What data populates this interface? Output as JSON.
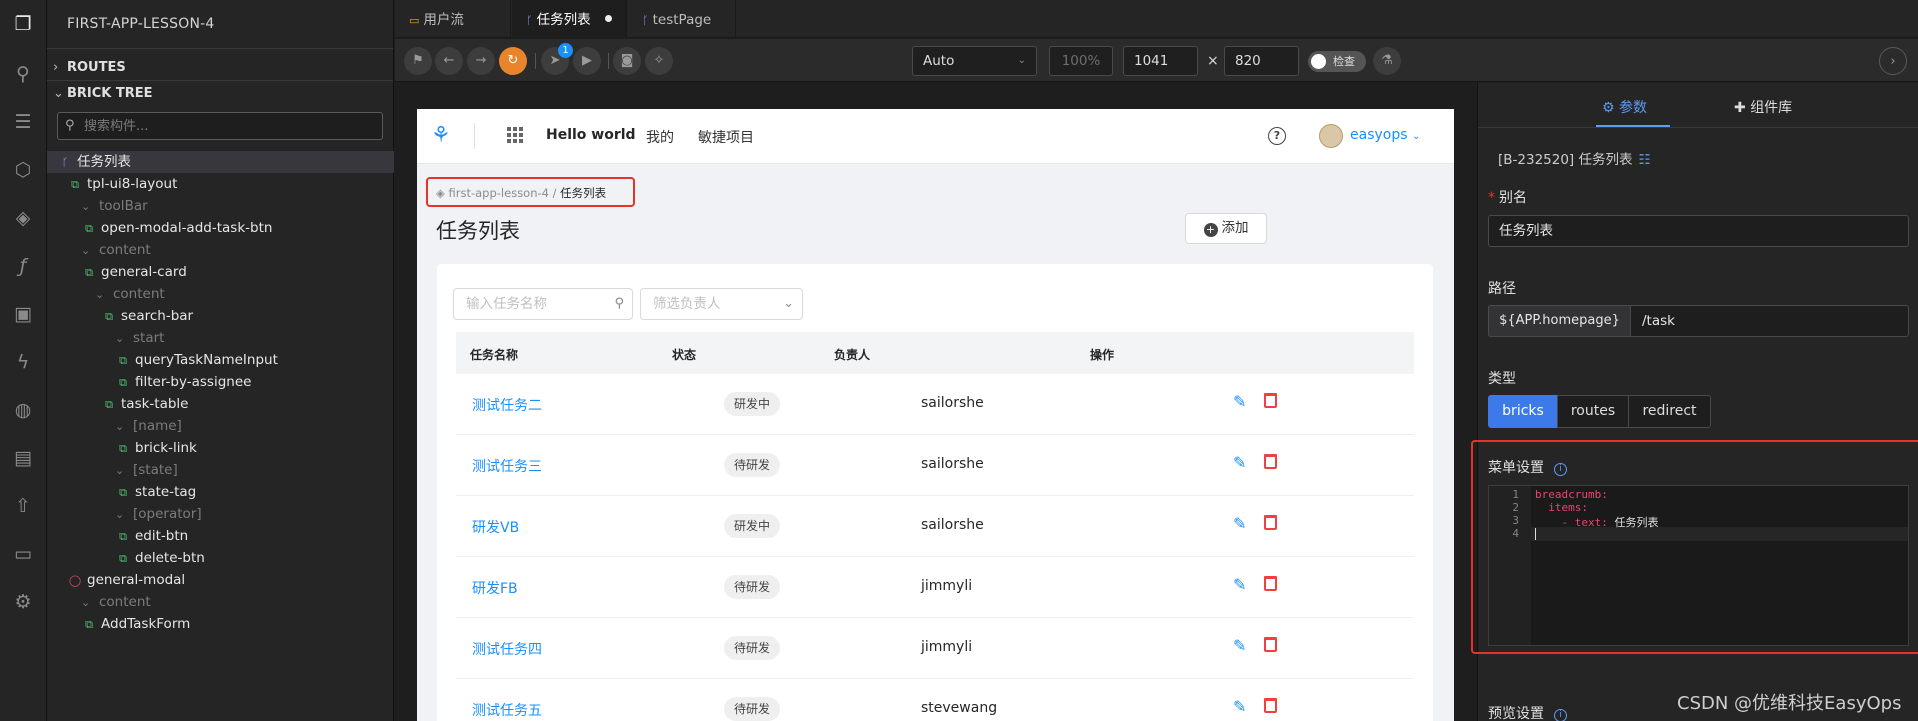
{
  "sidebar": {
    "project_title": "FIRST-APP-LESSON-4",
    "routes_label": "ROUTES",
    "brick_tree_label": "BRICK TREE",
    "search_placeholder": "搜索构件...",
    "tree": [
      {
        "label": "任务列表",
        "type": "route"
      },
      {
        "label": "tpl-ui8-layout",
        "type": "brick"
      },
      {
        "label": "toolBar",
        "type": "slot"
      },
      {
        "label": "open-modal-add-task-btn",
        "type": "brick"
      },
      {
        "label": "content",
        "type": "slot"
      },
      {
        "label": "general-card",
        "type": "brick"
      },
      {
        "label": "content",
        "type": "slot"
      },
      {
        "label": "search-bar",
        "type": "brick"
      },
      {
        "label": "start",
        "type": "slot"
      },
      {
        "label": "queryTaskNameInput",
        "type": "brick"
      },
      {
        "label": "filter-by-assignee",
        "type": "brick"
      },
      {
        "label": "task-table",
        "type": "brick"
      },
      {
        "label": "[name]",
        "type": "slot"
      },
      {
        "label": "brick-link",
        "type": "brick"
      },
      {
        "label": "[state]",
        "type": "slot"
      },
      {
        "label": "state-tag",
        "type": "brick"
      },
      {
        "label": "[operator]",
        "type": "slot"
      },
      {
        "label": "edit-btn",
        "type": "brick"
      },
      {
        "label": "delete-btn",
        "type": "brick"
      },
      {
        "label": "general-modal",
        "type": "modal"
      },
      {
        "label": "content",
        "type": "slot"
      },
      {
        "label": "AddTaskForm",
        "type": "brick"
      }
    ]
  },
  "tabs": [
    {
      "label": "用户流"
    },
    {
      "label": "任务列表"
    },
    {
      "label": "testPage"
    }
  ],
  "toolbar": {
    "send_badge": "1",
    "device": "Auto",
    "zoom": "100%",
    "width": "1041",
    "times": "×",
    "height": "820",
    "inspect_label": "检查"
  },
  "preview": {
    "nav": {
      "app_name": "Hello world",
      "items": [
        "我的",
        "敏捷项目"
      ],
      "help": "?",
      "user": "easyops"
    },
    "breadcrumb": {
      "parent": "first-app-lesson-4",
      "separator": "/",
      "current": "任务列表"
    },
    "page_title": "任务列表",
    "add_button": "添加",
    "filters": {
      "name_placeholder": "输入任务名称",
      "assignee_placeholder": "筛选负责人"
    },
    "table": {
      "columns": [
        "任务名称",
        "状态",
        "负责人",
        "操作"
      ],
      "rows": [
        {
          "name": "测试任务二",
          "state": "研发中",
          "owner": "sailorshe"
        },
        {
          "name": "测试任务三",
          "state": "待研发",
          "owner": "sailorshe"
        },
        {
          "name": "研发VB",
          "state": "研发中",
          "owner": "sailorshe"
        },
        {
          "name": "研发FB",
          "state": "待研发",
          "owner": "jimmyli"
        },
        {
          "name": "测试任务四",
          "state": "待研发",
          "owner": "jimmyli"
        },
        {
          "name": "测试任务五",
          "state": "待研发",
          "owner": "stevewang"
        }
      ]
    }
  },
  "panel": {
    "tab_params": "参数",
    "tab_library": "组件库",
    "brick_id": "[B-232520] 任务列表",
    "alias_label": "别名",
    "alias_value": "任务列表",
    "path_label": "路径",
    "path_prefix": "${APP.homepage}",
    "path_value": "/task",
    "type_label": "类型",
    "type_options": [
      "bricks",
      "routes",
      "redirect"
    ],
    "type_selected": "bricks",
    "menu_label": "菜单设置",
    "code_lines": [
      {
        "num": "1",
        "key": "breadcrumb:",
        "rest": ""
      },
      {
        "num": "2",
        "key": "  items:",
        "rest": ""
      },
      {
        "num": "3",
        "key": "    - text:",
        "rest": " 任务列表"
      },
      {
        "num": "4",
        "key": "",
        "rest": ""
      }
    ],
    "preview_label": "预览设置"
  },
  "watermark": "CSDN @优维科技EasyOps"
}
